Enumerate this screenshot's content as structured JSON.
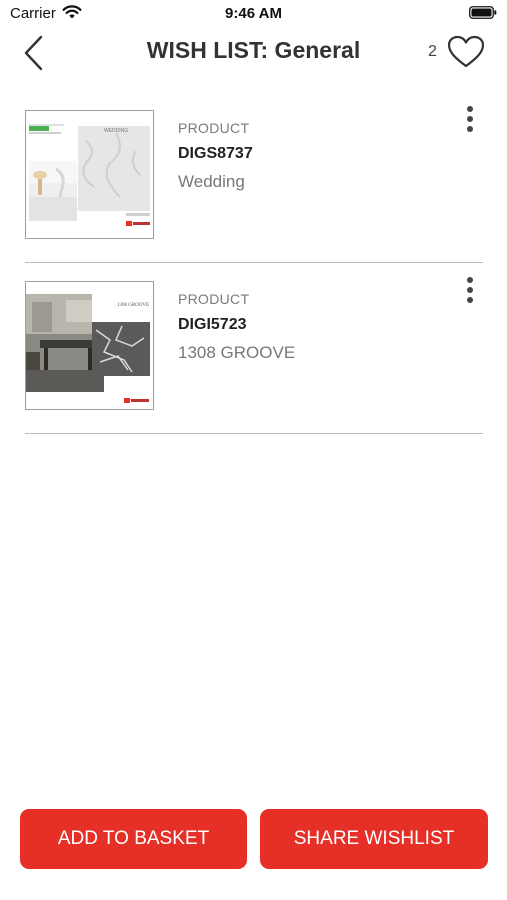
{
  "status_bar": {
    "carrier": "Carrier",
    "time": "9:46 AM"
  },
  "header": {
    "title": "WISH LIST: General",
    "count": "2"
  },
  "items": [
    {
      "type": "PRODUCT",
      "code": "DIGS8737",
      "name": "Wedding",
      "thumb_caption": "WEDDING",
      "thumb_brand": "TILESTREAM"
    },
    {
      "type": "PRODUCT",
      "code": "DIGI5723",
      "name": "1308 GROOVE",
      "thumb_caption": "1308 GROOVE",
      "thumb_brand": "TILESTREAM"
    }
  ],
  "footer": {
    "add_to_basket": "ADD TO BASKET",
    "share_wishlist": "SHARE WISHLIST"
  },
  "colors": {
    "accent": "#e63027",
    "divider": "#bdbdbd"
  }
}
